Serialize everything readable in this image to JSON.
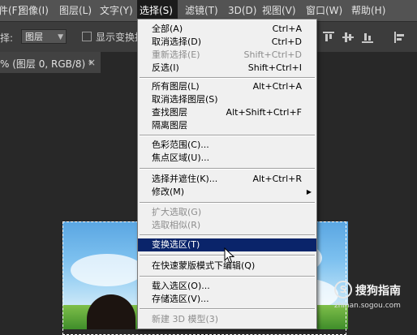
{
  "menubar": {
    "items": [
      "件(F)",
      "图像(I)",
      "图层(L)",
      "文字(Y)",
      "选择(S)",
      "滤镜(T)",
      "3D(D)",
      "视图(V)",
      "窗口(W)",
      "帮助(H)"
    ]
  },
  "options": {
    "label": "择:",
    "select_value": "图层",
    "checkbox_label": "显示变换控件"
  },
  "document_tab": {
    "title": "% (图层 0, RGB/8) *",
    "close_glyph": "×"
  },
  "select_menu": {
    "items": [
      {
        "label": "全部(A)",
        "shortcut": "Ctrl+A"
      },
      {
        "label": "取消选择(D)",
        "shortcut": "Ctrl+D"
      },
      {
        "label": "重新选择(E)",
        "shortcut": "Shift+Ctrl+D"
      },
      {
        "label": "反选(I)",
        "shortcut": "Shift+Ctrl+I"
      },
      {
        "label": "所有图层(L)",
        "shortcut": "Alt+Ctrl+A"
      },
      {
        "label": "取消选择图层(S)",
        "shortcut": ""
      },
      {
        "label": "查找图层",
        "shortcut": "Alt+Shift+Ctrl+F"
      },
      {
        "label": "隔离图层",
        "shortcut": ""
      },
      {
        "label": "色彩范围(C)...",
        "shortcut": ""
      },
      {
        "label": "焦点区域(U)...",
        "shortcut": ""
      },
      {
        "label": "选择并遮住(K)...",
        "shortcut": "Alt+Ctrl+R"
      },
      {
        "label": "修改(M)",
        "shortcut": ""
      },
      {
        "label": "扩大选取(G)",
        "shortcut": ""
      },
      {
        "label": "选取相似(R)",
        "shortcut": ""
      },
      {
        "label": "变换选区(T)",
        "shortcut": ""
      },
      {
        "label": "在快速蒙版模式下编辑(Q)",
        "shortcut": ""
      },
      {
        "label": "载入选区(O)...",
        "shortcut": ""
      },
      {
        "label": "存储选区(V)...",
        "shortcut": ""
      },
      {
        "label": "新建 3D 模型(3)",
        "shortcut": ""
      }
    ]
  },
  "watermark": {
    "text": "搜狗指南",
    "domain": "zhinan.sogou.com",
    "logo_glyph": "S"
  },
  "colors": {
    "menubar_bg": "#535353",
    "menu_highlight": "#0a246a",
    "menu_bg": "#f0f0f0",
    "disabled_text": "#8d8d8d"
  }
}
